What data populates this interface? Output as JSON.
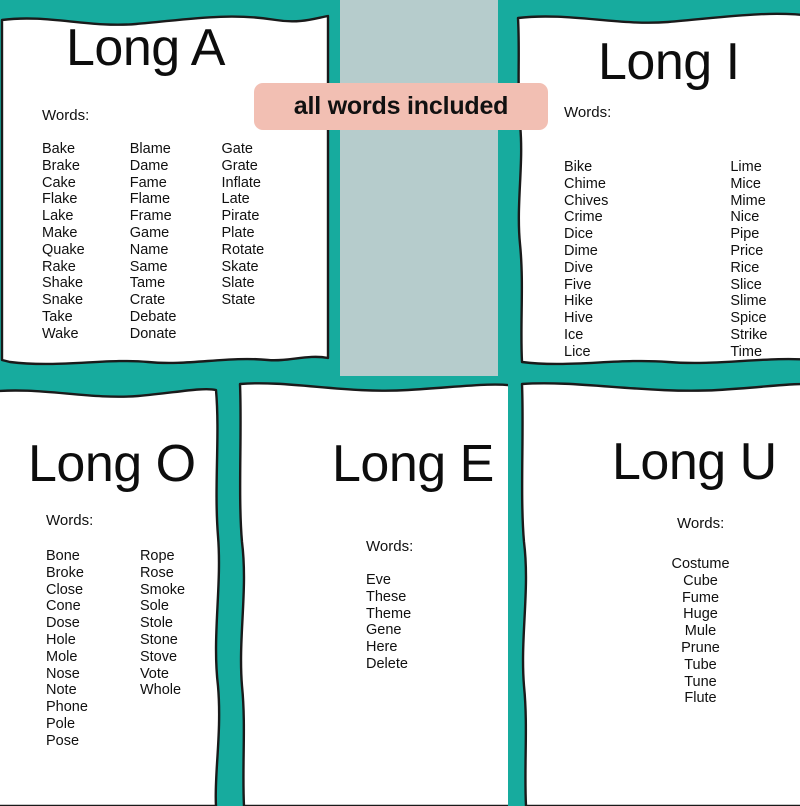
{
  "badge": {
    "text": "all words included"
  },
  "colors": {
    "background": "#b6cccc",
    "teal_border": "#17ab9e",
    "badge_pink": "#f2bfb3",
    "card_white": "#ffffff",
    "outline": "#1a1a1a",
    "text": "#101010"
  },
  "labels": {
    "words": "Words:"
  },
  "posters": [
    {
      "id": "long-a",
      "title": "Long A",
      "words_label": "Words:",
      "columns": [
        [
          "Bake",
          "Brake",
          "Cake",
          "Flake",
          "Lake",
          "Make",
          "Quake",
          "Rake",
          "Shake",
          "Snake",
          "Take",
          "Wake"
        ],
        [
          "Blame",
          "Dame",
          "Fame",
          "Flame",
          "Frame",
          "Game",
          "Name",
          "Same",
          "Tame",
          "Crate",
          "Debate",
          "Donate"
        ],
        [
          "Gate",
          "Grate",
          "Inflate",
          "Late",
          "Pirate",
          "Plate",
          "Rotate",
          "Skate",
          "Slate",
          "State"
        ]
      ]
    },
    {
      "id": "long-i",
      "title": "Long I",
      "words_label": "Words:",
      "columns": [
        [
          "Bike",
          "Chime",
          "Chives",
          "Crime",
          "Dice",
          "Dime",
          "Dive",
          "Five",
          "Hike",
          "Hive",
          "Ice",
          "Lice"
        ],
        [
          "Lime",
          "Mice",
          "Mime",
          "Nice",
          "Pipe",
          "Price",
          "Rice",
          "Slice",
          "Slime",
          "Spice",
          "Strike",
          "Time"
        ]
      ]
    },
    {
      "id": "long-o",
      "title": "Long O",
      "words_label": "Words:",
      "columns": [
        [
          "Bone",
          "Broke",
          "Close",
          "Cone",
          "Dose",
          "Hole",
          "Mole",
          "Nose",
          "Note",
          "Phone",
          "Pole",
          "Pose"
        ],
        [
          "Rope",
          "Rose",
          "Smoke",
          "Sole",
          "Stole",
          "Stone",
          "Stove",
          "Vote",
          "Whole"
        ]
      ]
    },
    {
      "id": "long-e",
      "title": "Long E",
      "words_label": "Words:",
      "columns": [
        [
          "Eve",
          "These",
          "Theme",
          "Gene",
          "Here",
          "Delete"
        ]
      ]
    },
    {
      "id": "long-u",
      "title": "Long U",
      "words_label": "Words:",
      "columns": [
        [
          "Costume",
          "Cube",
          "Fume",
          "Huge",
          "Mule",
          "Prune",
          "Tube",
          "Tune",
          "Flute"
        ]
      ]
    }
  ]
}
